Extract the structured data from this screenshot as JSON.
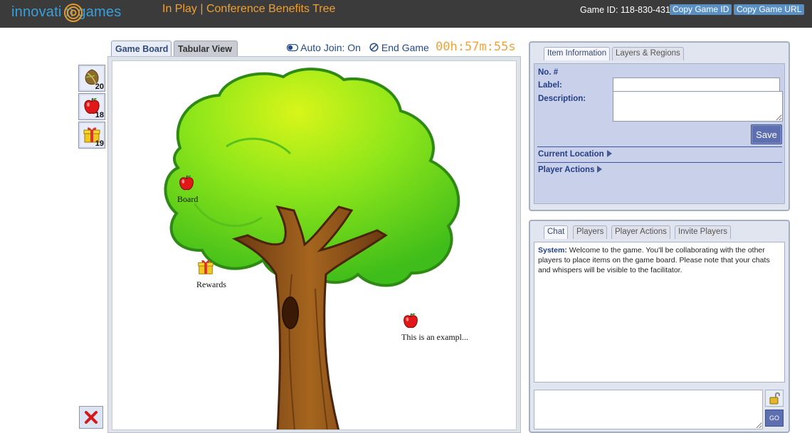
{
  "header": {
    "logo_text": "innovati  n games",
    "title": "In Play | Conference Benefits Tree",
    "game_id": "Game ID: 118-830-431",
    "copy_id_label": "Copy Game ID",
    "copy_url_label": "Copy Game URL"
  },
  "palette": {
    "items": [
      {
        "name": "leaf-token",
        "count": "20"
      },
      {
        "name": "apple-token",
        "count": "18"
      },
      {
        "name": "gift-token",
        "count": "19"
      }
    ]
  },
  "board_tabs": {
    "game_board": "Game Board",
    "tabular_view": "Tabular View"
  },
  "controls": {
    "auto_join": "Auto Join: On",
    "end_game": "End Game",
    "timer": "00h:57m:55s"
  },
  "board_items": [
    {
      "type": "apple",
      "label": "Board"
    },
    {
      "type": "gift",
      "label": "Rewards"
    },
    {
      "type": "apple",
      "label": "This is an exampl..."
    }
  ],
  "info_panel": {
    "tabs": [
      "Item Information",
      "Layers & Regions"
    ],
    "no_label": "No. #",
    "label_label": "Label:",
    "description_label": "Description:",
    "label_value": "",
    "description_value": "",
    "save_label": "Save",
    "current_location": "Current Location",
    "player_actions": "Player Actions"
  },
  "chat_panel": {
    "tabs": [
      "Chat",
      "Players",
      "Player Actions",
      "Invite Players"
    ],
    "messages": [
      {
        "sender": "System:",
        "text": "Welcome to the game. You'll be collaborating with the other players to place items on the game board. Please note that your chats and whispers will be visible to the facilitator."
      }
    ],
    "go_label": "GO",
    "input_value": ""
  },
  "colors": {
    "header_bg": "#3b3b3b",
    "title_orange": "#f0a030",
    "timer_orange": "#f2a23c",
    "link_blue": "#234a8e",
    "panel_blue": "#c8d0ea"
  }
}
